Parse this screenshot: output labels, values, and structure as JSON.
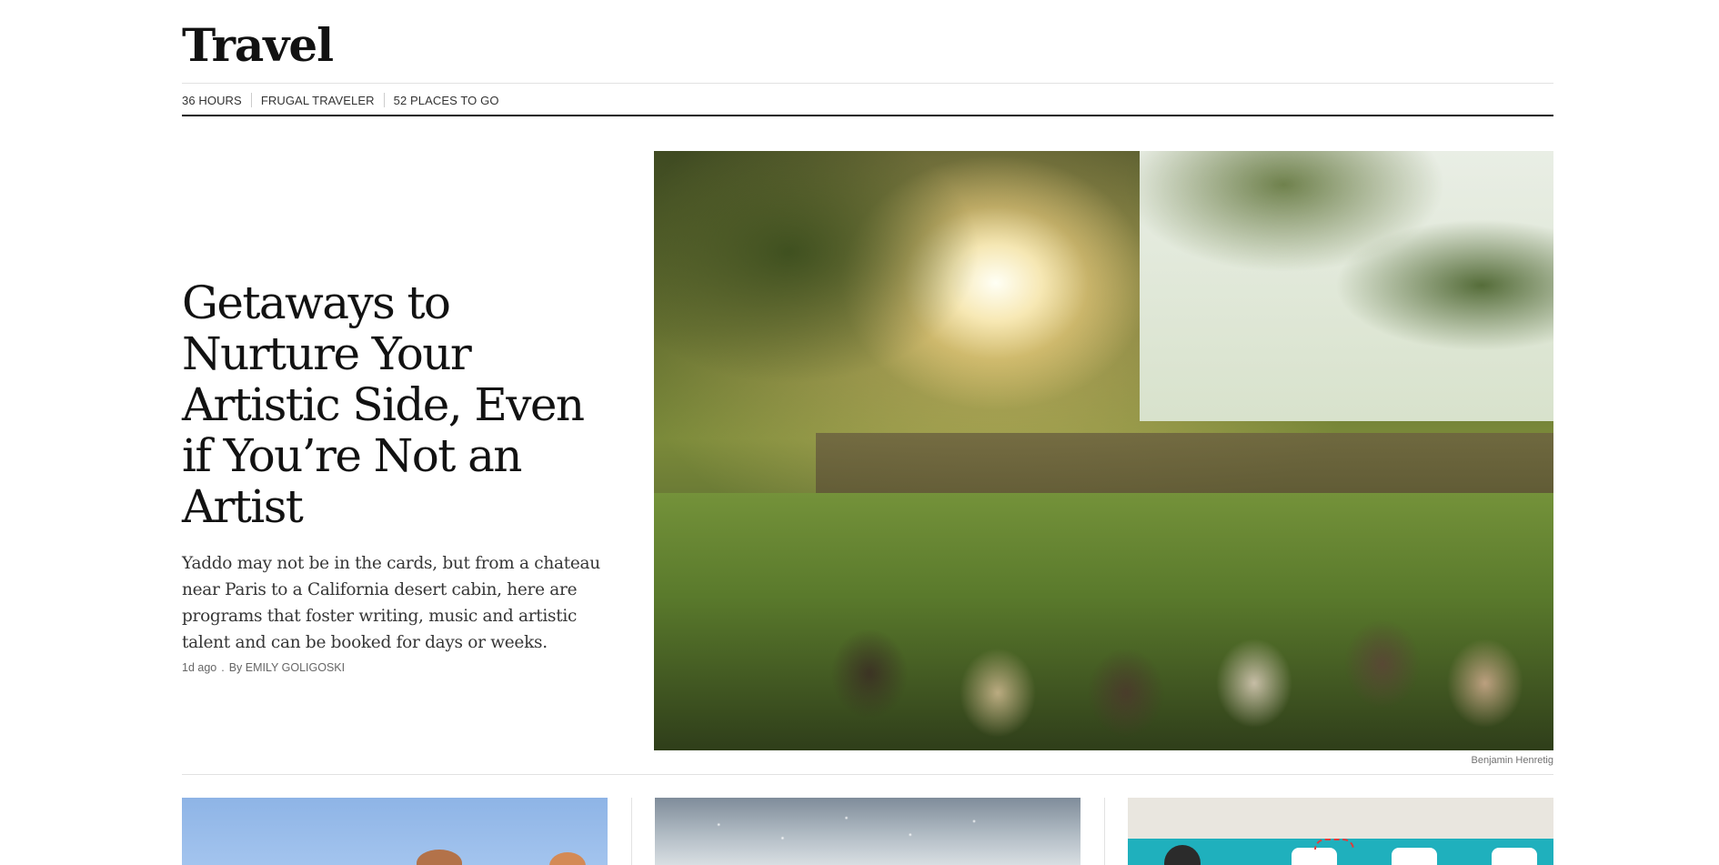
{
  "section": {
    "title": "Travel"
  },
  "subnav": {
    "items": [
      {
        "label": "36 Hours"
      },
      {
        "label": "Frugal Traveler"
      },
      {
        "label": "52 Places to Go"
      }
    ]
  },
  "lede": {
    "headline": "Getaways to Nurture Your Artistic Side, Even if You’re Not an Artist",
    "summary": "Yaddo may not be in the cards, but from a chateau near Paris to a California desert cabin, here are programs that foster writing, music and artistic talent and can be booked for days or weeks.",
    "timestamp": "1d ago",
    "byline_prefix": "By",
    "author": "Emily Goligoski",
    "image_credit": "Benjamin Henretig"
  }
}
